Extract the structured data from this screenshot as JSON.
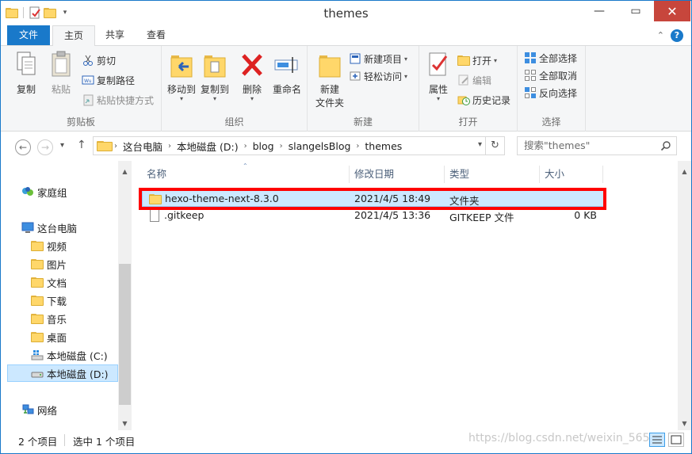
{
  "window": {
    "title": "themes",
    "colors": {
      "accent": "#1979ca",
      "close": "#c7463c",
      "selection": "#cce8ff",
      "highlight_box": "#ff0000"
    }
  },
  "ribbon_tabs": {
    "file": "文件",
    "home": "主页",
    "share": "共享",
    "view": "查看"
  },
  "ribbon": {
    "clipboard": {
      "label": "剪贴板",
      "copy": "复制",
      "paste": "粘贴",
      "cut": "剪切",
      "copy_path": "复制路径",
      "paste_shortcut": "粘贴快捷方式"
    },
    "organize": {
      "label": "组织",
      "move_to": "移动到",
      "copy_to": "复制到",
      "delete": "删除",
      "rename": "重命名"
    },
    "new": {
      "label": "新建",
      "new_folder_line1": "新建",
      "new_folder_line2": "文件夹",
      "new_item": "新建项目",
      "easy_access": "轻松访问"
    },
    "open": {
      "label": "打开",
      "properties": "属性",
      "open": "打开",
      "edit": "编辑",
      "history": "历史记录"
    },
    "select": {
      "label": "选择",
      "select_all": "全部选择",
      "select_none": "全部取消",
      "invert": "反向选择"
    }
  },
  "address": {
    "crumbs": [
      "这台电脑",
      "本地磁盘 (D:)",
      "blog",
      "slangelsBlog",
      "themes"
    ],
    "search_placeholder": "搜索\"themes\""
  },
  "nav_pane": {
    "homegroup": "家庭组",
    "this_pc": "这台电脑",
    "items": [
      "视频",
      "图片",
      "文档",
      "下载",
      "音乐",
      "桌面",
      "本地磁盘 (C:)",
      "本地磁盘 (D:)"
    ],
    "network": "网络"
  },
  "columns": {
    "name": "名称",
    "modified": "修改日期",
    "type": "类型",
    "size": "大小"
  },
  "files": [
    {
      "name": "hexo-theme-next-8.3.0",
      "modified": "2021/4/5 18:49",
      "type": "文件夹",
      "size": ""
    },
    {
      "name": ".gitkeep",
      "modified": "2021/4/5 13:36",
      "type": "GITKEEP 文件",
      "size": "0 KB"
    }
  ],
  "status": {
    "count": "2 个项目",
    "selected": "选中 1 个项目",
    "watermark": "https://blog.csdn.net/weixin_565"
  }
}
